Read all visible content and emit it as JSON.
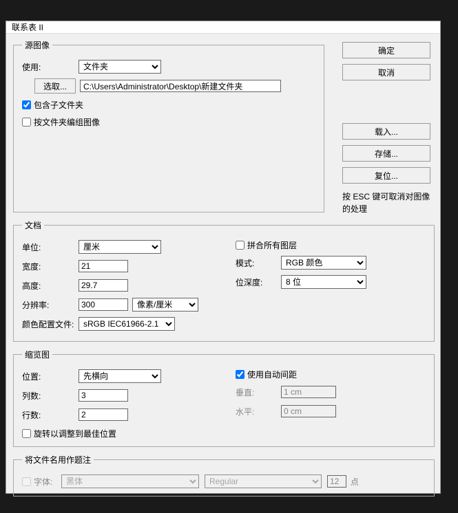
{
  "title": "联系表 II",
  "buttons": {
    "ok": "确定",
    "cancel": "取消",
    "load": "载入...",
    "save": "存储...",
    "reset": "复位..."
  },
  "hint": "按 ESC 键可取消对图像的处理",
  "source": {
    "legend": "源图像",
    "use_label": "使用:",
    "use_value": "文件夹",
    "choose_btn": "选取...",
    "path": "C:\\Users\\Administrator\\Desktop\\新建文件夹",
    "include_sub": "包含子文件夹",
    "group_by_folder": "按文件夹编组图像"
  },
  "doc": {
    "legend": "文档",
    "unit_label": "单位:",
    "unit_value": "厘米",
    "width_label": "宽度:",
    "width_value": "21",
    "height_label": "高度:",
    "height_value": "29.7",
    "res_label": "分辨率:",
    "res_value": "300",
    "res_unit": "像素/厘米",
    "profile_label": "颜色配置文件:",
    "profile_value": "sRGB IEC61966-2.1",
    "flatten": "拼合所有图层",
    "mode_label": "模式:",
    "mode_value": "RGB 颜色",
    "depth_label": "位深度:",
    "depth_value": "8 位"
  },
  "thumb": {
    "legend": "缩览图",
    "pos_label": "位置:",
    "pos_value": "先横向",
    "cols_label": "列数:",
    "cols_value": "3",
    "rows_label": "行数:",
    "rows_value": "2",
    "rotate": "旋转以调整到最佳位置",
    "auto_spacing": "使用自动间距",
    "vert_label": "垂直:",
    "vert_value": "1 cm",
    "horiz_label": "水平:",
    "horiz_value": "0 cm"
  },
  "caption": {
    "legend": "将文件名用作题注",
    "font_label": "字体:",
    "font_value": "黑体",
    "style_value": "Regular",
    "size_value": "12",
    "size_unit": "点"
  }
}
